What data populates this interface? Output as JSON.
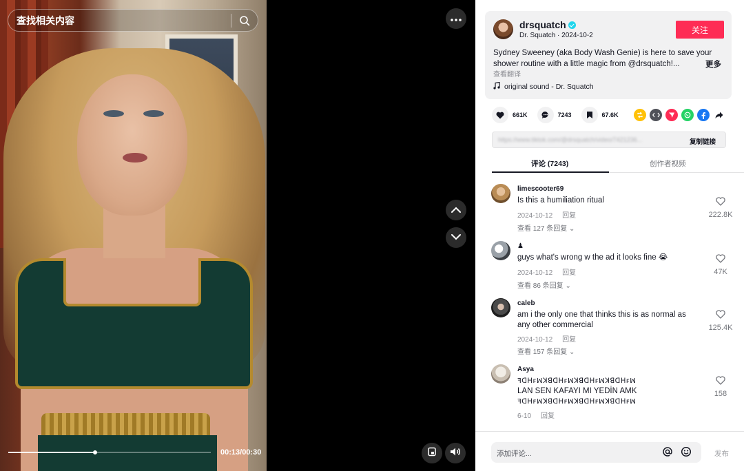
{
  "search": {
    "placeholder": "查找相关内容",
    "icon": "search-icon"
  },
  "player": {
    "time": "00:13/00:30",
    "progress_fraction": 0.43,
    "nav_up_icon": "chevron-up-icon",
    "nav_down_icon": "chevron-down-icon"
  },
  "author": {
    "username": "drsquatch",
    "meta": "Dr. Squatch · 2024-10-2",
    "follow_label": "关注",
    "description": "Sydney Sweeney (aka Body Wash Genie) is here to save your shower routine with a little magic from @drsquatch!...",
    "more_label": "更多",
    "translate_label": "查看翻译",
    "sound": "original sound - Dr. Squatch"
  },
  "actions": {
    "likes": "661K",
    "comments": "7243",
    "saves": "67.6K"
  },
  "link": {
    "url": "https://www.tiktok.com/@drsquatch/video/7421236...",
    "copy_label": "复制链接"
  },
  "tabs": {
    "comments": "评论 (7243)",
    "videos": "创作者视频"
  },
  "comments": [
    {
      "user": "limescooter69",
      "text": "Is this a humiliation ritual",
      "date": "2024-10-12",
      "reply": "回复",
      "more": "查看 127 条回复",
      "likes": "222.8K"
    },
    {
      "user": "♟",
      "text": "guys what's wrong w the ad it looks fine 😭",
      "date": "2024-10-12",
      "reply": "回复",
      "more": "查看 86 条回复",
      "likes": "47K"
    },
    {
      "user": "caleb",
      "text": "am i the only one that thinks this is as normal as any other commercial",
      "date": "2024-10-12",
      "reply": "回复",
      "more": "查看 157 条回复",
      "likes": "125.4K"
    },
    {
      "user": "Asya",
      "line1": "ꟻꓷꓧꜰꟽꓘꓭꓷꓧꜰꟽꓘꓭꓷꓧꜰꟽꓘꓭꓷꓧꜰꟽ",
      "text": "LAN SEN KAFAYI MI YEDİN AMK",
      "line3": "ꟻꓷꓧꜰꟽꓘꓭꓷꓧꜰꟽꓘꓭꓷꓧꜰꟽꓘꓭꓷꓧꜰꟽ",
      "date": "6-10",
      "reply": "回复",
      "likes": "158"
    }
  ],
  "footer": {
    "placeholder": "添加评论...",
    "post_label": "发布"
  },
  "colors": {
    "accent": "#fe2c55",
    "text": "#161823",
    "muted": "#8a8b91",
    "verified": "#20d5ec"
  }
}
